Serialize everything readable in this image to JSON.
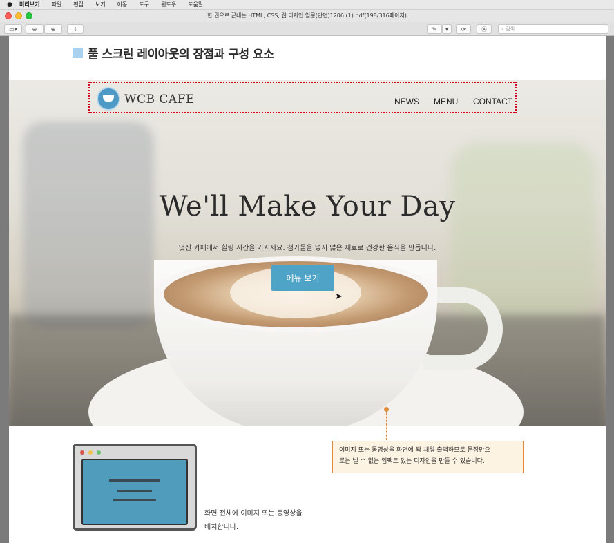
{
  "menubar": {
    "apple": "",
    "items": [
      "미리보기",
      "파일",
      "편집",
      "보기",
      "이동",
      "도구",
      "윈도우",
      "도움말"
    ]
  },
  "window": {
    "title": "한 권으로 끝내는 HTML, CSS, 웹 디자인 입문(단면)1206 (1).pdf(198/316페이지)"
  },
  "toolbar": {
    "search_placeholder": "검색"
  },
  "page": {
    "heading": "풀 스크린 레이아웃의 장점과 구성 요소",
    "site": {
      "logo_text": "WCB CAFE",
      "nav": [
        "NEWS",
        "MENU",
        "CONTACT"
      ],
      "hero_title": "We'll Make Your Day",
      "hero_subtitle": "멋진 카페에서 힐링 시간을 가지세요. 첨가물을 넣지 않은 재료로 건강한 음식을 만듭니다.",
      "hero_button": "메뉴 보기"
    },
    "callout": {
      "line1": "이미지 또는 동영상을 화면에 꽉 채워 출력하므로 문장만으",
      "line2": "로는 낼 수 없는 임팩트 있는 디자인을 만들 수 있습니다."
    },
    "caption": {
      "line1": "화면 전체에 이미지 또는 동영상을",
      "line2": "배치합니다."
    }
  },
  "colors": {
    "heading_square": "#a8d2ef",
    "hero_button": "#4fa3c6",
    "callout_border": "#e08a3c",
    "nav_highlight_border": "#d0021b"
  }
}
